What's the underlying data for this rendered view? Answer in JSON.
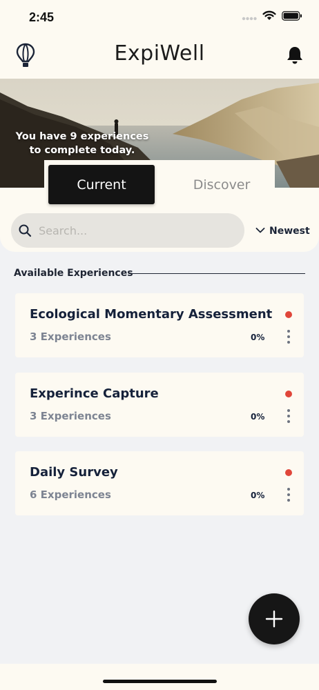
{
  "status_bar": {
    "time": "2:45"
  },
  "header": {
    "title": "ExpiWell",
    "left_icon": "balloon-icon",
    "right_icon": "bell-icon"
  },
  "hero": {
    "message": "You have 9 experiences to complete today."
  },
  "tabs": [
    {
      "label": "Current",
      "active": true
    },
    {
      "label": "Discover",
      "active": false
    }
  ],
  "search": {
    "placeholder": "Search...",
    "value": ""
  },
  "sort": {
    "label": "Newest"
  },
  "section": {
    "title": "Available Experiences"
  },
  "experiences": [
    {
      "title": "Ecological Momentary Assessment",
      "count": "3 Experiences",
      "progress": "0%"
    },
    {
      "title": "Experince Capture",
      "count": "3 Experiences",
      "progress": "0%"
    },
    {
      "title": "Daily Survey",
      "count": "6 Experiences",
      "progress": "0%"
    }
  ],
  "colors": {
    "accent_dark": "#141414",
    "status_dot": "#e0463a",
    "cream": "#fdfaf2"
  }
}
